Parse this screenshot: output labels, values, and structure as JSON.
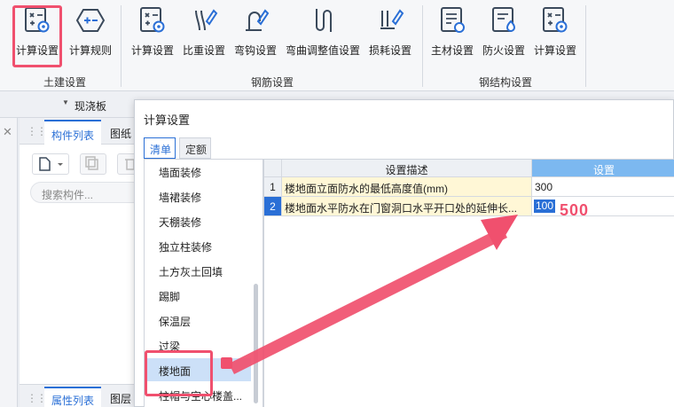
{
  "ribbon": {
    "groups": [
      {
        "label": "土建设置",
        "tools": [
          "计算设置",
          "计算规则"
        ]
      },
      {
        "label": "钢筋设置",
        "tools": [
          "计算设置",
          "比重设置",
          "弯钩设置",
          "弯曲调整值设置",
          "损耗设置"
        ]
      },
      {
        "label": "钢结构设置",
        "tools": [
          "主材设置",
          "防火设置",
          "计算设置"
        ]
      }
    ],
    "icons": [
      "calc-settings-icon",
      "calc-rules-icon",
      "calc-settings-icon",
      "density-icon",
      "hook-icon",
      "bend-adjust-icon",
      "loss-icon",
      "main-material-icon",
      "fire-icon",
      "calc-settings-icon"
    ]
  },
  "subbar": {
    "selected": "现浇板"
  },
  "left_panel": {
    "tabs": [
      "构件列表",
      "图纸"
    ],
    "search_placeholder": "搜索构件...",
    "bottom_tabs": [
      "属性列表",
      "图层"
    ]
  },
  "dialog": {
    "title": "计算设置",
    "tabs": [
      "清单",
      "定额"
    ],
    "list_items": [
      "墙面装修",
      "墙裙装修",
      "天棚装修",
      "独立柱装修",
      "土方灰土回填",
      "踢脚",
      "保温层",
      "过梁",
      "楼地面",
      "柱帽与空心楼盖..."
    ],
    "selected_item": "楼地面",
    "grid": {
      "columns": [
        "设置描述",
        "设置"
      ],
      "rows": [
        {
          "no": "1",
          "desc": "楼地面立面防水的最低高度值(mm)",
          "value": "300"
        },
        {
          "no": "2",
          "desc": "楼地面水平防水在门窗洞口水平开口处的延伸长...",
          "value": "100"
        }
      ],
      "selected_row": 2
    }
  },
  "annotation": {
    "text": "500",
    "color": "#f0506e"
  },
  "colors": {
    "accent": "#2a6fd6",
    "highlight": "#f0506e",
    "header_selected": "#7cb8f0"
  }
}
